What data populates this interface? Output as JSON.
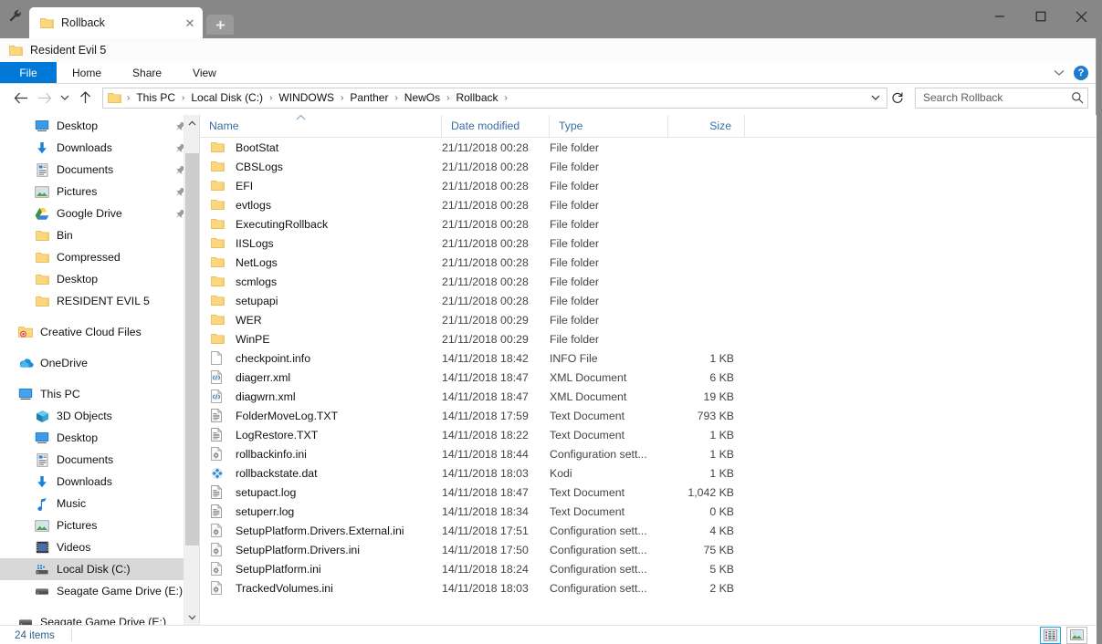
{
  "window": {
    "tab_title": "Rollback",
    "folder_title": "Resident Evil 5",
    "close_label": "✕",
    "new_tab_label": "+",
    "minimize_label": "—",
    "maximize_label": "☐",
    "window_close_label": "✕"
  },
  "ribbon": {
    "file": "File",
    "tabs": [
      "Home",
      "Share",
      "View"
    ],
    "expand_label": "˅",
    "help_label": "?"
  },
  "address": {
    "back": "←",
    "forward": "→",
    "recent": "˅",
    "up": "↑",
    "crumbs": [
      "This PC",
      "Local Disk (C:)",
      "WINDOWS",
      "Panther",
      "NewOs",
      "Rollback"
    ],
    "separator": "›",
    "dropdown": "˅",
    "refresh": "↻"
  },
  "search": {
    "placeholder": "Search Rollback",
    "value": ""
  },
  "sidebar": {
    "quick_access": [
      {
        "label": "Desktop",
        "icon": "desktop-icon",
        "pinned": true
      },
      {
        "label": "Downloads",
        "icon": "downloads-icon",
        "pinned": true
      },
      {
        "label": "Documents",
        "icon": "documents-icon",
        "pinned": true
      },
      {
        "label": "Pictures",
        "icon": "pictures-icon",
        "pinned": true
      },
      {
        "label": "Google Drive",
        "icon": "google-drive-icon",
        "pinned": true
      },
      {
        "label": "Bin",
        "icon": "folder-icon",
        "pinned": false
      },
      {
        "label": "Compressed",
        "icon": "folder-icon",
        "pinned": false
      },
      {
        "label": "Desktop",
        "icon": "folder-icon",
        "pinned": false
      },
      {
        "label": "RESIDENT EVIL 5",
        "icon": "folder-icon",
        "pinned": false
      }
    ],
    "creative_cloud": {
      "label": "Creative Cloud Files",
      "icon": "creative-cloud-icon"
    },
    "onedrive": {
      "label": "OneDrive",
      "icon": "onedrive-icon"
    },
    "this_pc": {
      "label": "This PC",
      "icon": "this-pc-icon"
    },
    "this_pc_children": [
      {
        "label": "3D Objects",
        "icon": "3d-objects-icon"
      },
      {
        "label": "Desktop",
        "icon": "desktop-icon"
      },
      {
        "label": "Documents",
        "icon": "documents-icon"
      },
      {
        "label": "Downloads",
        "icon": "downloads-icon"
      },
      {
        "label": "Music",
        "icon": "music-icon"
      },
      {
        "label": "Pictures",
        "icon": "pictures-icon"
      },
      {
        "label": "Videos",
        "icon": "videos-icon"
      },
      {
        "label": "Local Disk (C:)",
        "icon": "local-disk-icon",
        "selected": true
      },
      {
        "label": "Seagate Game Drive (E:)",
        "icon": "drive-icon"
      }
    ],
    "network_drive": {
      "label": "Seagate Game Drive (E:)",
      "icon": "drive-icon"
    },
    "scroll_up": "˄",
    "scroll_down": "˅",
    "pin_glyph": "📌"
  },
  "columns": {
    "name": "Name",
    "date_modified": "Date modified",
    "type": "Type",
    "size": "Size",
    "sort_indicator": "˄"
  },
  "files": [
    {
      "name": "BootStat",
      "date": "21/11/2018 00:28",
      "type": "File folder",
      "size": "",
      "icon": "folder-icon"
    },
    {
      "name": "CBSLogs",
      "date": "21/11/2018 00:28",
      "type": "File folder",
      "size": "",
      "icon": "folder-icon"
    },
    {
      "name": "EFI",
      "date": "21/11/2018 00:28",
      "type": "File folder",
      "size": "",
      "icon": "folder-icon"
    },
    {
      "name": "evtlogs",
      "date": "21/11/2018 00:28",
      "type": "File folder",
      "size": "",
      "icon": "folder-icon"
    },
    {
      "name": "ExecutingRollback",
      "date": "21/11/2018 00:28",
      "type": "File folder",
      "size": "",
      "icon": "folder-icon"
    },
    {
      "name": "IISLogs",
      "date": "21/11/2018 00:28",
      "type": "File folder",
      "size": "",
      "icon": "folder-icon"
    },
    {
      "name": "NetLogs",
      "date": "21/11/2018 00:28",
      "type": "File folder",
      "size": "",
      "icon": "folder-icon"
    },
    {
      "name": "scmlogs",
      "date": "21/11/2018 00:28",
      "type": "File folder",
      "size": "",
      "icon": "folder-icon"
    },
    {
      "name": "setupapi",
      "date": "21/11/2018 00:28",
      "type": "File folder",
      "size": "",
      "icon": "folder-icon"
    },
    {
      "name": "WER",
      "date": "21/11/2018 00:29",
      "type": "File folder",
      "size": "",
      "icon": "folder-icon"
    },
    {
      "name": "WinPE",
      "date": "21/11/2018 00:29",
      "type": "File folder",
      "size": "",
      "icon": "folder-icon"
    },
    {
      "name": "checkpoint.info",
      "date": "14/11/2018 18:42",
      "type": "INFO File",
      "size": "1 KB",
      "icon": "blank-file-icon"
    },
    {
      "name": "diagerr.xml",
      "date": "14/11/2018 18:47",
      "type": "XML Document",
      "size": "6 KB",
      "icon": "xml-file-icon"
    },
    {
      "name": "diagwrn.xml",
      "date": "14/11/2018 18:47",
      "type": "XML Document",
      "size": "19 KB",
      "icon": "xml-file-icon"
    },
    {
      "name": "FolderMoveLog.TXT",
      "date": "14/11/2018 17:59",
      "type": "Text Document",
      "size": "793 KB",
      "icon": "text-file-icon"
    },
    {
      "name": "LogRestore.TXT",
      "date": "14/11/2018 18:22",
      "type": "Text Document",
      "size": "1 KB",
      "icon": "text-file-icon"
    },
    {
      "name": "rollbackinfo.ini",
      "date": "14/11/2018 18:44",
      "type": "Configuration sett...",
      "size": "1 KB",
      "icon": "ini-file-icon"
    },
    {
      "name": "rollbackstate.dat",
      "date": "14/11/2018 18:03",
      "type": "Kodi",
      "size": "1 KB",
      "icon": "kodi-file-icon"
    },
    {
      "name": "setupact.log",
      "date": "14/11/2018 18:47",
      "type": "Text Document",
      "size": "1,042 KB",
      "icon": "text-file-icon"
    },
    {
      "name": "setuperr.log",
      "date": "14/11/2018 18:34",
      "type": "Text Document",
      "size": "0 KB",
      "icon": "text-file-icon"
    },
    {
      "name": "SetupPlatform.Drivers.External.ini",
      "date": "14/11/2018 17:51",
      "type": "Configuration sett...",
      "size": "4 KB",
      "icon": "ini-file-icon"
    },
    {
      "name": "SetupPlatform.Drivers.ini",
      "date": "14/11/2018 17:50",
      "type": "Configuration sett...",
      "size": "75 KB",
      "icon": "ini-file-icon"
    },
    {
      "name": "SetupPlatform.ini",
      "date": "14/11/2018 18:24",
      "type": "Configuration sett...",
      "size": "5 KB",
      "icon": "ini-file-icon"
    },
    {
      "name": "TrackedVolumes.ini",
      "date": "14/11/2018 18:03",
      "type": "Configuration sett...",
      "size": "2 KB",
      "icon": "ini-file-icon"
    }
  ],
  "status": {
    "item_count": "24 items"
  },
  "colors": {
    "accent": "#0078d7",
    "titlebar": "#878787",
    "folder": "#fcd77f",
    "column_header_text": "#3a6ea5",
    "selection": "#d8d8d8"
  }
}
